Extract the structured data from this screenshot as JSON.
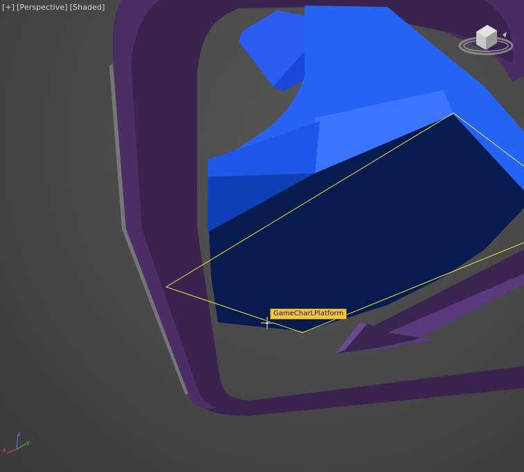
{
  "viewport": {
    "label_plus": "[+]",
    "label_view": "[Perspective]",
    "label_shading": "[Shaded]"
  },
  "tooltip": {
    "text": "GameCharLPlatform"
  },
  "axis_gizmo": {
    "x": "x",
    "y": "y",
    "z": "z"
  },
  "colors": {
    "viewport_bg": "#4b4b4b",
    "frame_purple": "#3d2550",
    "body_blue": "#1a4fe6",
    "selection_yellow": "#e6e64a",
    "tooltip_bg": "#f5c542"
  },
  "icons": {
    "viewcube": "viewcube-icon",
    "cursor": "move-cursor-icon",
    "axis": "axis-tripod-icon"
  }
}
